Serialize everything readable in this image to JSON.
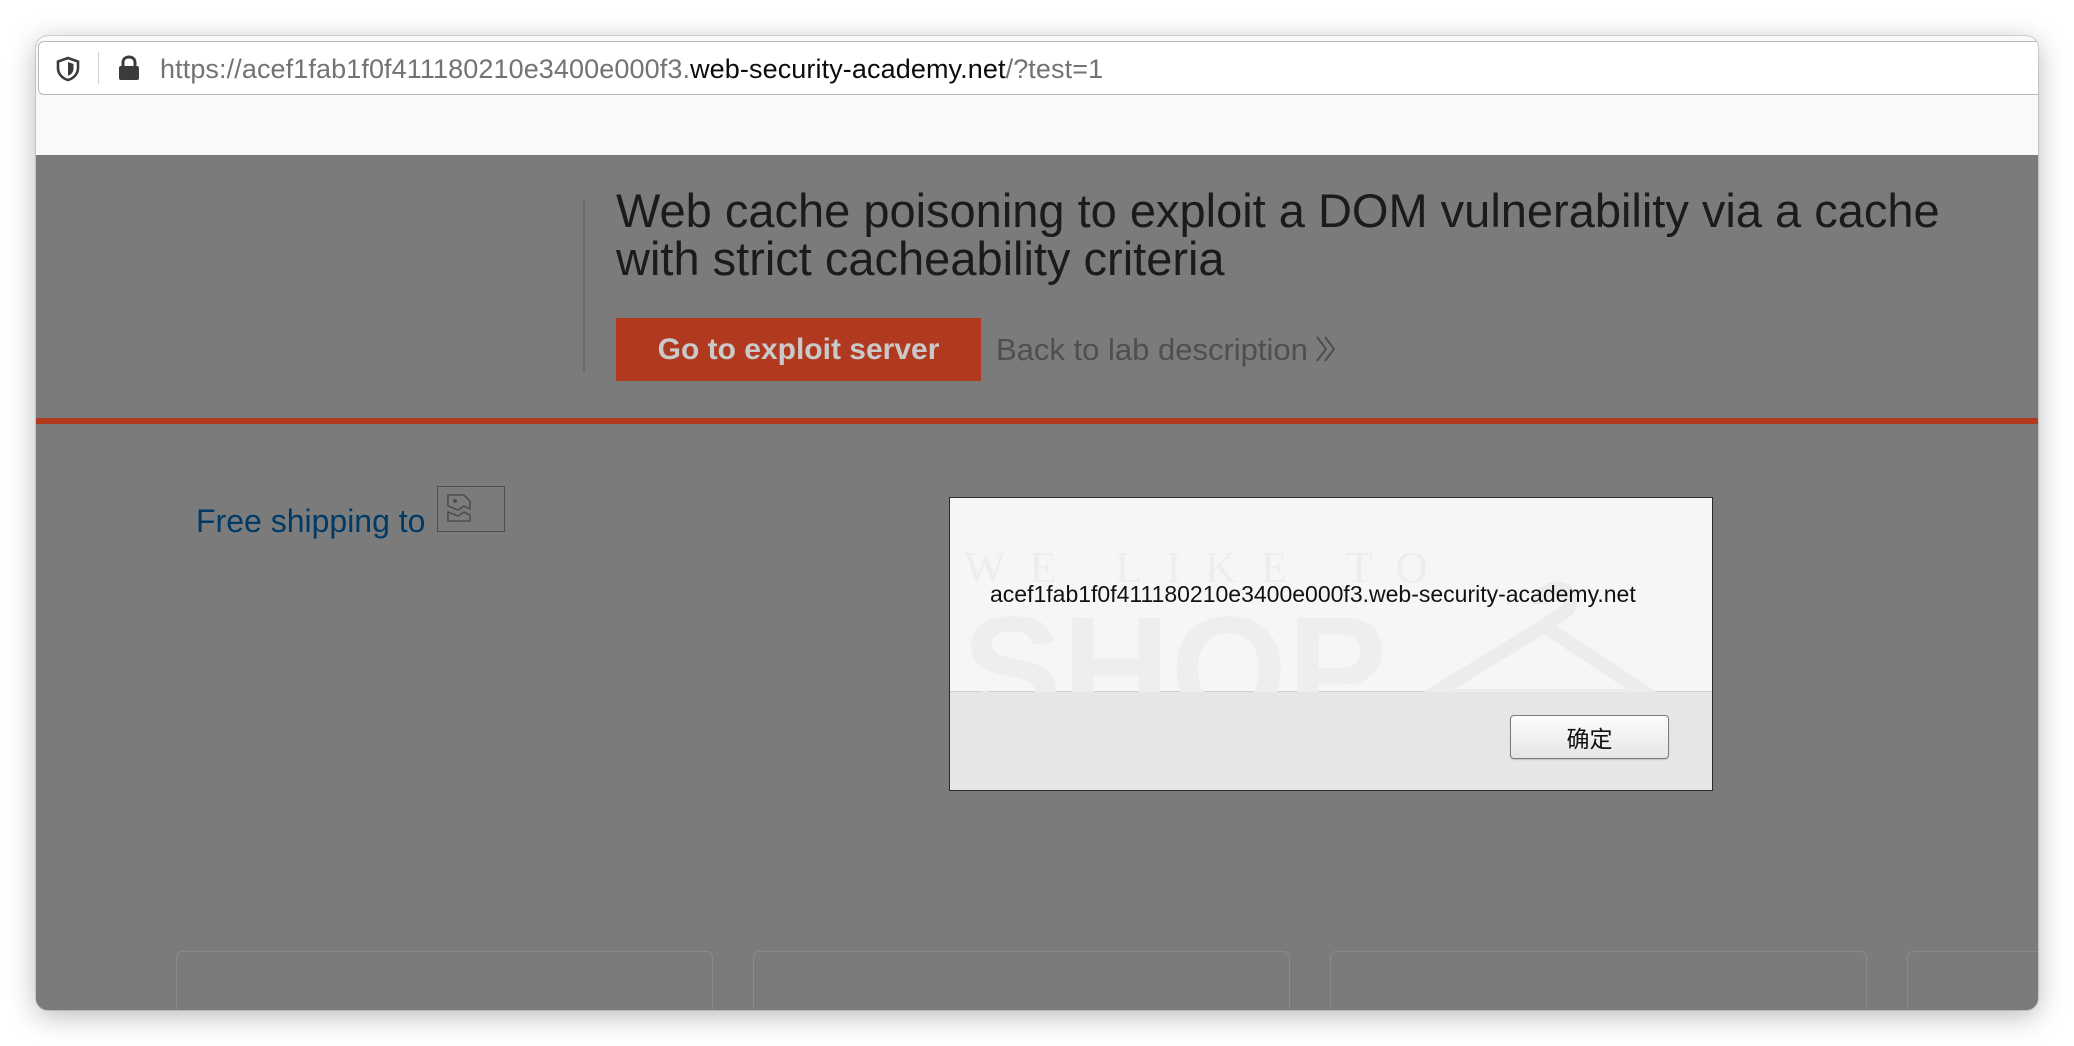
{
  "browser": {
    "url_prefix": "https://acef1fab1f0f411180210e3400e000f3.",
    "url_domain": "web-security-academy.net",
    "url_suffix": "/?test=1"
  },
  "header": {
    "title": "Web cache poisoning to exploit a DOM vulnerability via a cache with strict cacheability criteria",
    "exploit_button": "Go to exploit server",
    "back_link": "Back to lab description"
  },
  "content": {
    "free_shipping": "Free shipping to"
  },
  "dialog": {
    "message": "acef1fab1f0f411180210e3400e000f3.web-security-academy.net",
    "ok_label": "确定",
    "watermark_small": "WE LIKE TO",
    "watermark_big": "SHOP"
  },
  "colors": {
    "accent": "#b0391f",
    "link": "#003a66",
    "overlay": "#7b7b7b"
  }
}
